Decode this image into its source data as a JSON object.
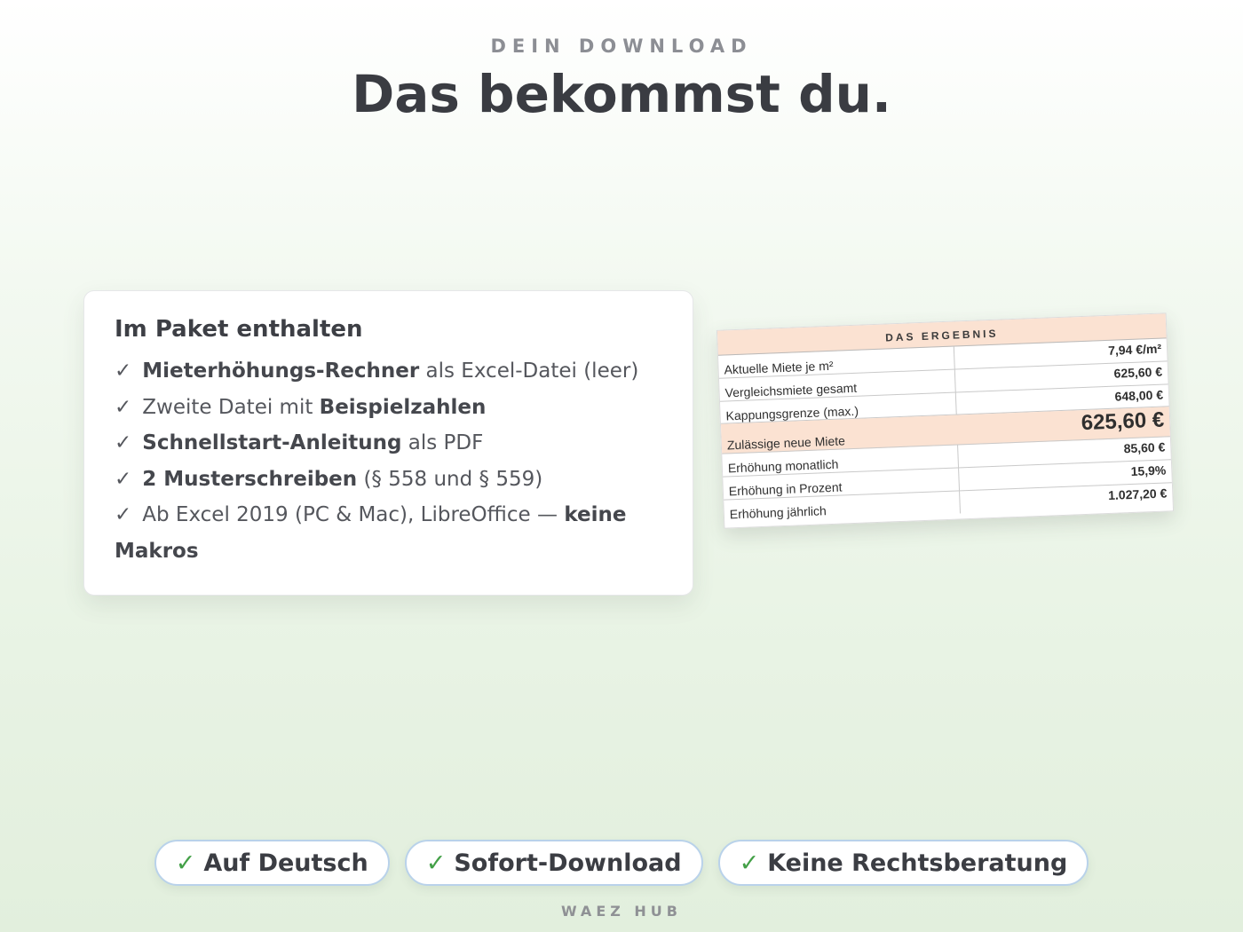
{
  "header": {
    "eyebrow": "DEIN DOWNLOAD",
    "title": "Das bekommst du."
  },
  "package": {
    "heading": "Im Paket enthalten",
    "check_symbol": "✓",
    "items": [
      {
        "pre": "",
        "bold": "Mieterhöhungs-Rechner",
        "post": " als Excel-Datei (leer)"
      },
      {
        "pre": "Zweite Datei mit ",
        "bold": "Beispielzahlen",
        "post": ""
      },
      {
        "pre": "",
        "bold": "Schnellstart-Anleitung",
        "post": " als PDF"
      },
      {
        "pre": "",
        "bold": "2 Musterschreiben",
        "post": " (§ 558 und § 559)"
      },
      {
        "pre": "Ab Excel 2019 (PC & Mac), LibreOffice — ",
        "bold": "keine Makros",
        "post": ""
      }
    ]
  },
  "result_sheet": {
    "heading": "DAS ERGEBNIS",
    "rows": [
      {
        "label": "Aktuelle Miete je m²",
        "value": "7,94 €/m²",
        "highlight": false
      },
      {
        "label": "Vergleichsmiete gesamt",
        "value": "625,60 €",
        "highlight": false
      },
      {
        "label": "Kappungsgrenze (max.)",
        "value": "648,00 €",
        "highlight": false
      },
      {
        "label": "Zulässige neue Miete",
        "value": "625,60 €",
        "highlight": true
      },
      {
        "label": "Erhöhung monatlich",
        "value": "85,60 €",
        "highlight": false
      },
      {
        "label": "Erhöhung in Prozent",
        "value": "15,9%",
        "highlight": false
      },
      {
        "label": "Erhöhung jährlich",
        "value": "1.027,20 €",
        "highlight": false
      }
    ]
  },
  "badges": [
    {
      "check": "✓",
      "label": "Auf Deutsch"
    },
    {
      "check": "✓",
      "label": "Sofort-Download"
    },
    {
      "check": "✓",
      "label": "Keine Rechtsberatung"
    }
  ],
  "footer": {
    "brand": "WAEZ HUB"
  },
  "colors": {
    "accent_check": "#43a047",
    "badge_border": "#b9d2ea",
    "sheet_highlight": "#fbe2d2"
  },
  "icons": {
    "list_marker": "check-icon",
    "badge_marker": "check-icon"
  }
}
